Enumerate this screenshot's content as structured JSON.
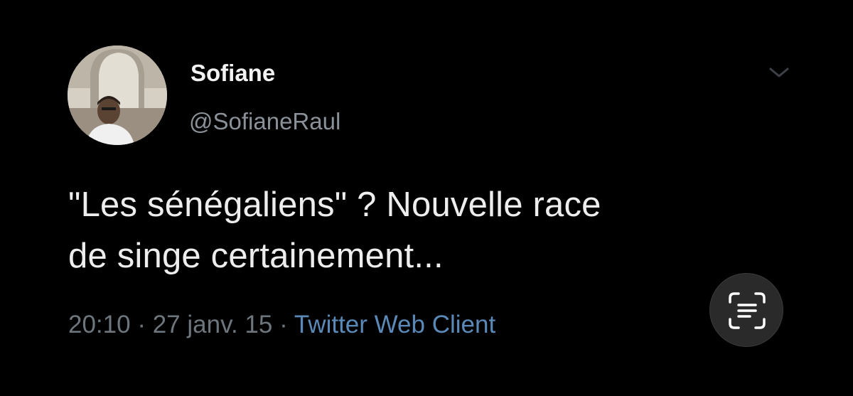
{
  "tweet": {
    "display_name": "Sofiane",
    "handle": "@SofianeRaul",
    "text_line1": "\"Les sénégaliens\" ? Nouvelle race",
    "text_line2": "de singe certainement...",
    "time": "20:10",
    "separator": "·",
    "date": "27 janv. 15",
    "source": "Twitter Web Client"
  },
  "icons": {
    "menu": "chevron-down-icon",
    "avatar": "avatar",
    "overlay": "live-text-scan-icon"
  },
  "colors": {
    "background": "#000000",
    "source_link": "#5a89b8",
    "meta_text": "#6e767d"
  }
}
